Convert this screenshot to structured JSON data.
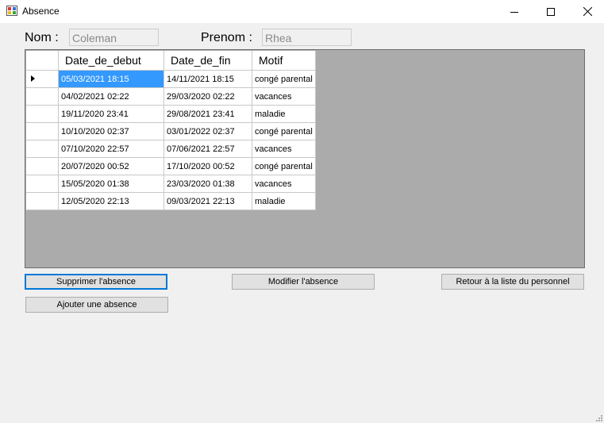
{
  "window": {
    "title": "Absence",
    "icon": "app-form-icon"
  },
  "header": {
    "nom_label": "Nom :",
    "nom_value": "Coleman",
    "prenom_label": "Prenom :",
    "prenom_value": "Rhea"
  },
  "grid": {
    "columns": [
      "Date_de_debut",
      "Date_de_fin",
      "Motif"
    ],
    "rows": [
      [
        "05/03/2021 18:15",
        "14/11/2021 18:15",
        "congé parental"
      ],
      [
        "04/02/2021 02:22",
        "29/03/2020 02:22",
        "vacances"
      ],
      [
        "19/11/2020 23:41",
        "29/08/2021 23:41",
        "maladie"
      ],
      [
        "10/10/2020 02:37",
        "03/01/2022 02:37",
        "congé parental"
      ],
      [
        "07/10/2020 22:57",
        "07/06/2021 22:57",
        "vacances"
      ],
      [
        "20/07/2020 00:52",
        "17/10/2020 00:52",
        "congé parental"
      ],
      [
        "15/05/2020 01:38",
        "23/03/2020 01:38",
        "vacances"
      ],
      [
        "12/05/2020 22:13",
        "09/03/2021 22:13",
        "maladie"
      ]
    ],
    "selected_row": 0
  },
  "buttons": {
    "supprimer": "Supprimer l'absence",
    "modifier": "Modifier l'absence",
    "retour": "Retour à la liste du personnel",
    "ajouter": "Ajouter une absence"
  },
  "colors": {
    "selection": "#3399ff",
    "grid_background": "#ababab",
    "focus_border": "#0078d7"
  }
}
